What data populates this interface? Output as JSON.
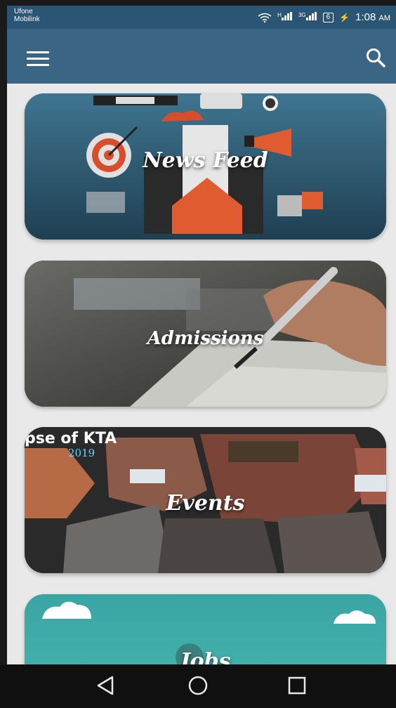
{
  "status_bar": {
    "carrier_1": "Ufone",
    "carrier_2": "Mobilink",
    "signal_1": "H",
    "signal_2": "3G",
    "battery": "6",
    "time": "1:08",
    "ampm": "AM"
  },
  "app_bar": {
    "menu_icon": "hamburger-menu-icon",
    "search_icon": "search-icon",
    "color": "#3b6584"
  },
  "cards": [
    {
      "label": "News Feed"
    },
    {
      "label": "Admissions"
    },
    {
      "label": "Events",
      "banner_text": "pse of KTA",
      "banner_year": "2019"
    },
    {
      "label": "Jobs"
    }
  ],
  "nav_bar": {
    "back_icon": "back-triangle-icon",
    "home_icon": "home-circle-icon",
    "recents_icon": "recents-square-icon"
  }
}
